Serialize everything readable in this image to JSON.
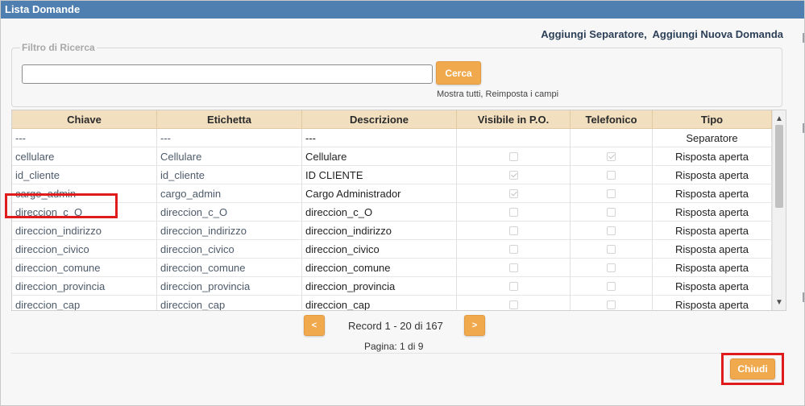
{
  "dialog": {
    "title": "Lista Domande",
    "links": {
      "add_separator": "Aggiungi Separatore",
      "separator": ",",
      "add_question": "Aggiungi Nuova Domanda"
    }
  },
  "filter": {
    "legend": "Filtro di Ricerca",
    "search_value": "",
    "search_button": "Cerca",
    "show_all": "Mostra tutti",
    "sep": ", ",
    "reset_fields": "Reimposta i campi"
  },
  "table": {
    "headers": {
      "key": "Chiave",
      "label": "Etichetta",
      "description": "Descrizione",
      "visible_po": "Visibile in P.O.",
      "phone": "Telefonico",
      "type": "Tipo"
    },
    "rows": [
      {
        "key": "---",
        "label": "---",
        "description": "---",
        "visible_po": null,
        "phone": null,
        "type": "Separatore"
      },
      {
        "key": "cellulare",
        "label": "Cellulare",
        "description": "Cellulare",
        "visible_po": false,
        "phone": true,
        "type": "Risposta aperta"
      },
      {
        "key": "id_cliente",
        "label": "id_cliente",
        "description": "ID CLIENTE",
        "visible_po": true,
        "phone": false,
        "type": "Risposta aperta"
      },
      {
        "key": "cargo_admin",
        "label": "cargo_admin",
        "description": "Cargo Administrador",
        "visible_po": true,
        "phone": false,
        "type": "Risposta aperta"
      },
      {
        "key": "direccion_c_O",
        "label": "direccion_c_O",
        "description": "direccion_c_O",
        "visible_po": false,
        "phone": false,
        "type": "Risposta aperta"
      },
      {
        "key": "direccion_indirizzo",
        "label": "direccion_indirizzo",
        "description": "direccion_indirizzo",
        "visible_po": false,
        "phone": false,
        "type": "Risposta aperta"
      },
      {
        "key": "direccion_civico",
        "label": "direccion_civico",
        "description": "direccion_civico",
        "visible_po": false,
        "phone": false,
        "type": "Risposta aperta"
      },
      {
        "key": "direccion_comune",
        "label": "direccion_comune",
        "description": "direccion_comune",
        "visible_po": false,
        "phone": false,
        "type": "Risposta aperta"
      },
      {
        "key": "direccion_provincia",
        "label": "direccion_provincia",
        "description": "direccion_provincia",
        "visible_po": false,
        "phone": false,
        "type": "Risposta aperta"
      },
      {
        "key": "direccion_cap",
        "label": "direccion_cap",
        "description": "direccion_cap",
        "visible_po": false,
        "phone": false,
        "type": "Risposta aperta"
      }
    ]
  },
  "pagination": {
    "prev": "<",
    "next": ">",
    "record_info": "Record 1 - 20 di 167",
    "page_info": "Pagina: 1 di 9"
  },
  "footer": {
    "close": "Chiudi"
  },
  "scroll": {
    "up_icon": "chevron-up-icon",
    "down_icon": "chevron-down-icon"
  },
  "colors": {
    "titlebar": "#4f7fb0",
    "header_bg": "#f2dfbf",
    "button": "#f0a94c",
    "highlight": "#e01b1b"
  }
}
